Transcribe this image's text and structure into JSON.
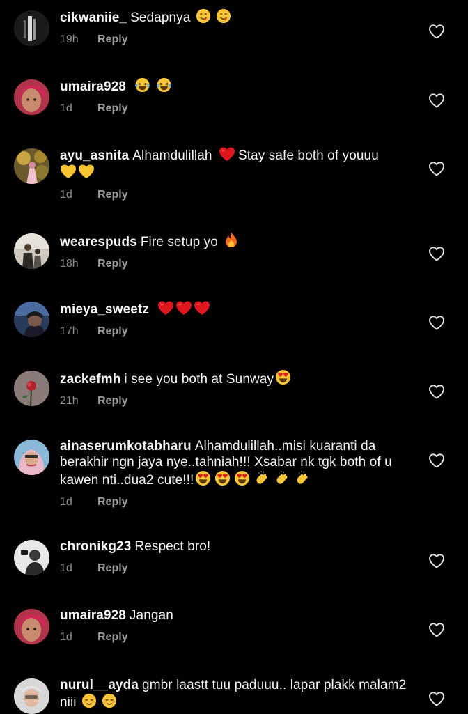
{
  "colors": {
    "background": "#000000",
    "text": "#f5f5f5",
    "meta": "#8e8e8e",
    "heart_red": "#e0161e",
    "heart_yellow": "#f7c531",
    "emoji_face": "#f8c63a",
    "fire": "#f26a20"
  },
  "comments": [
    {
      "username": "cikwaniie_",
      "text": "Sedapnya",
      "emojis": "yum-face-emoji yum-face-emoji",
      "time": "19h",
      "reply": "Reply"
    },
    {
      "username": "umaira928",
      "text": "",
      "emojis": "laughing-tears-emoji laughing-tears-emoji",
      "time": "1d",
      "reply": "Reply"
    },
    {
      "username": "ayu_asnita",
      "text": "Alhamdulillah",
      "text2": "Stay safe both of youuu",
      "emojis": "red-heart-emoji yellow-heart-emoji yellow-heart-emoji",
      "time": "1d",
      "reply": "Reply"
    },
    {
      "username": "wearespuds",
      "text": "Fire setup yo",
      "emojis": "fire-emoji",
      "time": "18h",
      "reply": "Reply"
    },
    {
      "username": "mieya_sweetz",
      "text": "",
      "emojis": "red-heart-emoji red-heart-emoji red-heart-emoji",
      "time": "17h",
      "reply": "Reply"
    },
    {
      "username": "zackefmh",
      "text": "i see you both at Sunway",
      "emojis": "heart-eyes-emoji",
      "time": "21h",
      "reply": "Reply"
    },
    {
      "username": "ainaserumkotabharu",
      "text": "Alhamdulillah..misi kuaranti da berakhir ngn jaya nye..tahniah!!! Xsabar nk tgk both of u kawen nti..dua2 cute!!!",
      "emojis": "heart-eyes-emoji x3 clapping-hands-emoji x3",
      "time": "1d",
      "reply": "Reply"
    },
    {
      "username": "chronikg23",
      "text": "Respect bro!",
      "emojis": "",
      "time": "1d",
      "reply": "Reply"
    },
    {
      "username": "umaira928",
      "text": "Jangan",
      "emojis": "",
      "time": "1d",
      "reply": "Reply"
    },
    {
      "username": "nurul__ayda",
      "text": "gmbr laastt tuu paduuu.. lapar plakk malam2 niii",
      "emojis": "relieved-face-emoji relieved-face-emoji",
      "time": "",
      "reply": ""
    }
  ]
}
